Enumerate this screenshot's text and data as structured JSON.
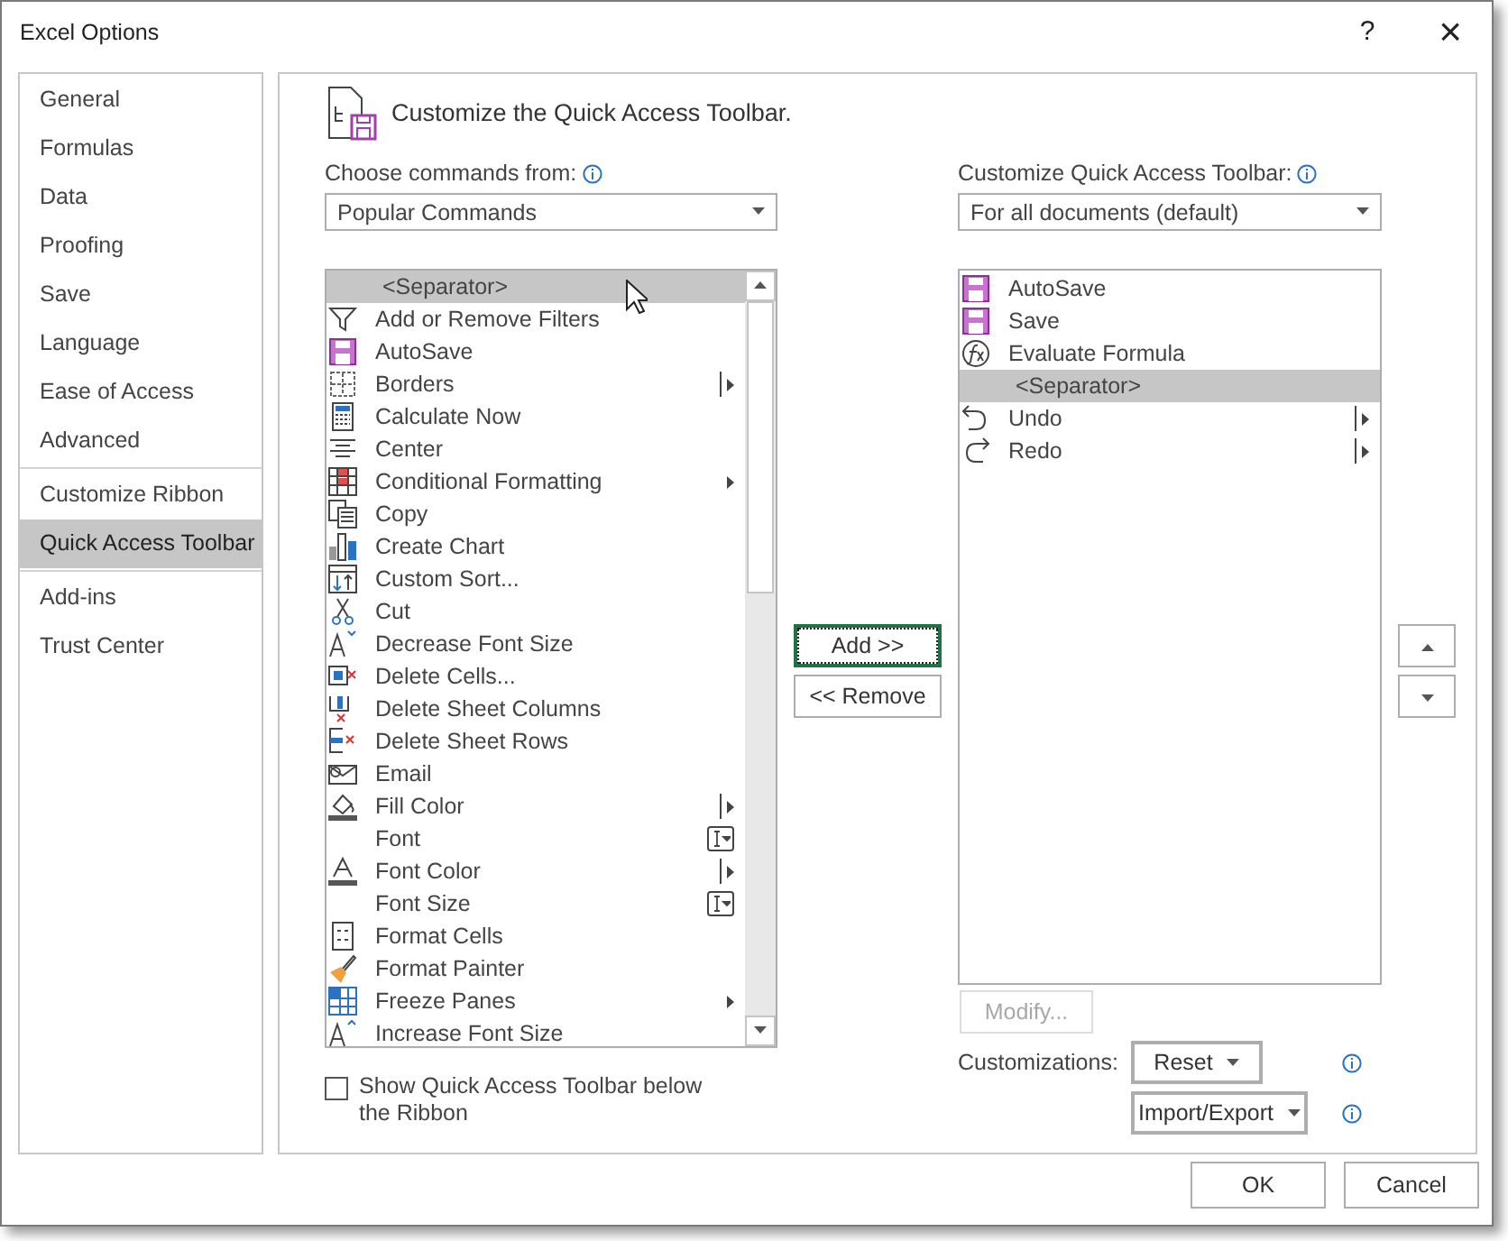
{
  "window": {
    "title": "Excel Options",
    "help": "?",
    "close": "×"
  },
  "sidebar": {
    "groups": [
      {
        "items": [
          {
            "label": "General",
            "selected": false
          },
          {
            "label": "Formulas",
            "selected": false
          },
          {
            "label": "Data",
            "selected": false
          },
          {
            "label": "Proofing",
            "selected": false
          },
          {
            "label": "Save",
            "selected": false
          },
          {
            "label": "Language",
            "selected": false
          },
          {
            "label": "Ease of Access",
            "selected": false
          },
          {
            "label": "Advanced",
            "selected": false
          }
        ]
      },
      {
        "items": [
          {
            "label": "Customize Ribbon",
            "selected": false
          },
          {
            "label": "Quick Access Toolbar",
            "selected": true
          }
        ]
      },
      {
        "items": [
          {
            "label": "Add-ins",
            "selected": false
          },
          {
            "label": "Trust Center",
            "selected": false
          }
        ]
      }
    ]
  },
  "header": {
    "title": "Customize the Quick Access Toolbar."
  },
  "commands": {
    "label": "Choose commands from:",
    "dropdown": "Popular Commands",
    "items": [
      {
        "label": "<Separator>",
        "kind": "separator",
        "selected": true
      },
      {
        "label": "Add or Remove Filters",
        "kind": "plain",
        "selected": false
      },
      {
        "label": "AutoSave",
        "kind": "plain",
        "selected": false
      },
      {
        "label": "Borders",
        "kind": "split",
        "selected": false
      },
      {
        "label": "Calculate Now",
        "kind": "plain",
        "selected": false
      },
      {
        "label": "Center",
        "kind": "plain",
        "selected": false
      },
      {
        "label": "Conditional Formatting",
        "kind": "menu",
        "selected": false
      },
      {
        "label": "Copy",
        "kind": "plain",
        "selected": false
      },
      {
        "label": "Create Chart",
        "kind": "plain",
        "selected": false
      },
      {
        "label": "Custom Sort...",
        "kind": "plain",
        "selected": false
      },
      {
        "label": "Cut",
        "kind": "plain",
        "selected": false
      },
      {
        "label": "Decrease Font Size",
        "kind": "plain",
        "selected": false
      },
      {
        "label": "Delete Cells...",
        "kind": "plain",
        "selected": false
      },
      {
        "label": "Delete Sheet Columns",
        "kind": "plain",
        "selected": false
      },
      {
        "label": "Delete Sheet Rows",
        "kind": "plain",
        "selected": false
      },
      {
        "label": "Email",
        "kind": "plain",
        "selected": false
      },
      {
        "label": "Fill Color",
        "kind": "split",
        "selected": false
      },
      {
        "label": "Font",
        "kind": "combo",
        "selected": false
      },
      {
        "label": "Font Color",
        "kind": "split",
        "selected": false
      },
      {
        "label": "Font Size",
        "kind": "combo",
        "selected": false
      },
      {
        "label": "Format Cells",
        "kind": "plain",
        "selected": false
      },
      {
        "label": "Format Painter",
        "kind": "plain",
        "selected": false
      },
      {
        "label": "Freeze Panes",
        "kind": "menu",
        "selected": false
      },
      {
        "label": "Increase Font Size",
        "kind": "plain",
        "selected": false
      }
    ]
  },
  "show_below": {
    "label": "Show Quick Access Toolbar below the Ribbon",
    "checked": false
  },
  "buttons": {
    "add": "Add >>",
    "remove": "<< Remove"
  },
  "toolbar": {
    "label": "Customize Quick Access Toolbar:",
    "dropdown": "For all documents (default)",
    "items": [
      {
        "label": "AutoSave",
        "kind": "plain",
        "selected": false
      },
      {
        "label": "Save",
        "kind": "plain",
        "selected": false
      },
      {
        "label": "Evaluate Formula",
        "kind": "plain",
        "selected": false
      },
      {
        "label": "<Separator>",
        "kind": "separator",
        "selected": true
      },
      {
        "label": "Undo",
        "kind": "split",
        "selected": false
      },
      {
        "label": "Redo",
        "kind": "split",
        "selected": false
      }
    ],
    "modify": {
      "label": "Modify...",
      "disabled": true
    }
  },
  "customizations": {
    "label": "Customizations:",
    "reset": "Reset",
    "import_export": "Import/Export"
  },
  "footer": {
    "ok": "OK",
    "cancel": "Cancel"
  }
}
